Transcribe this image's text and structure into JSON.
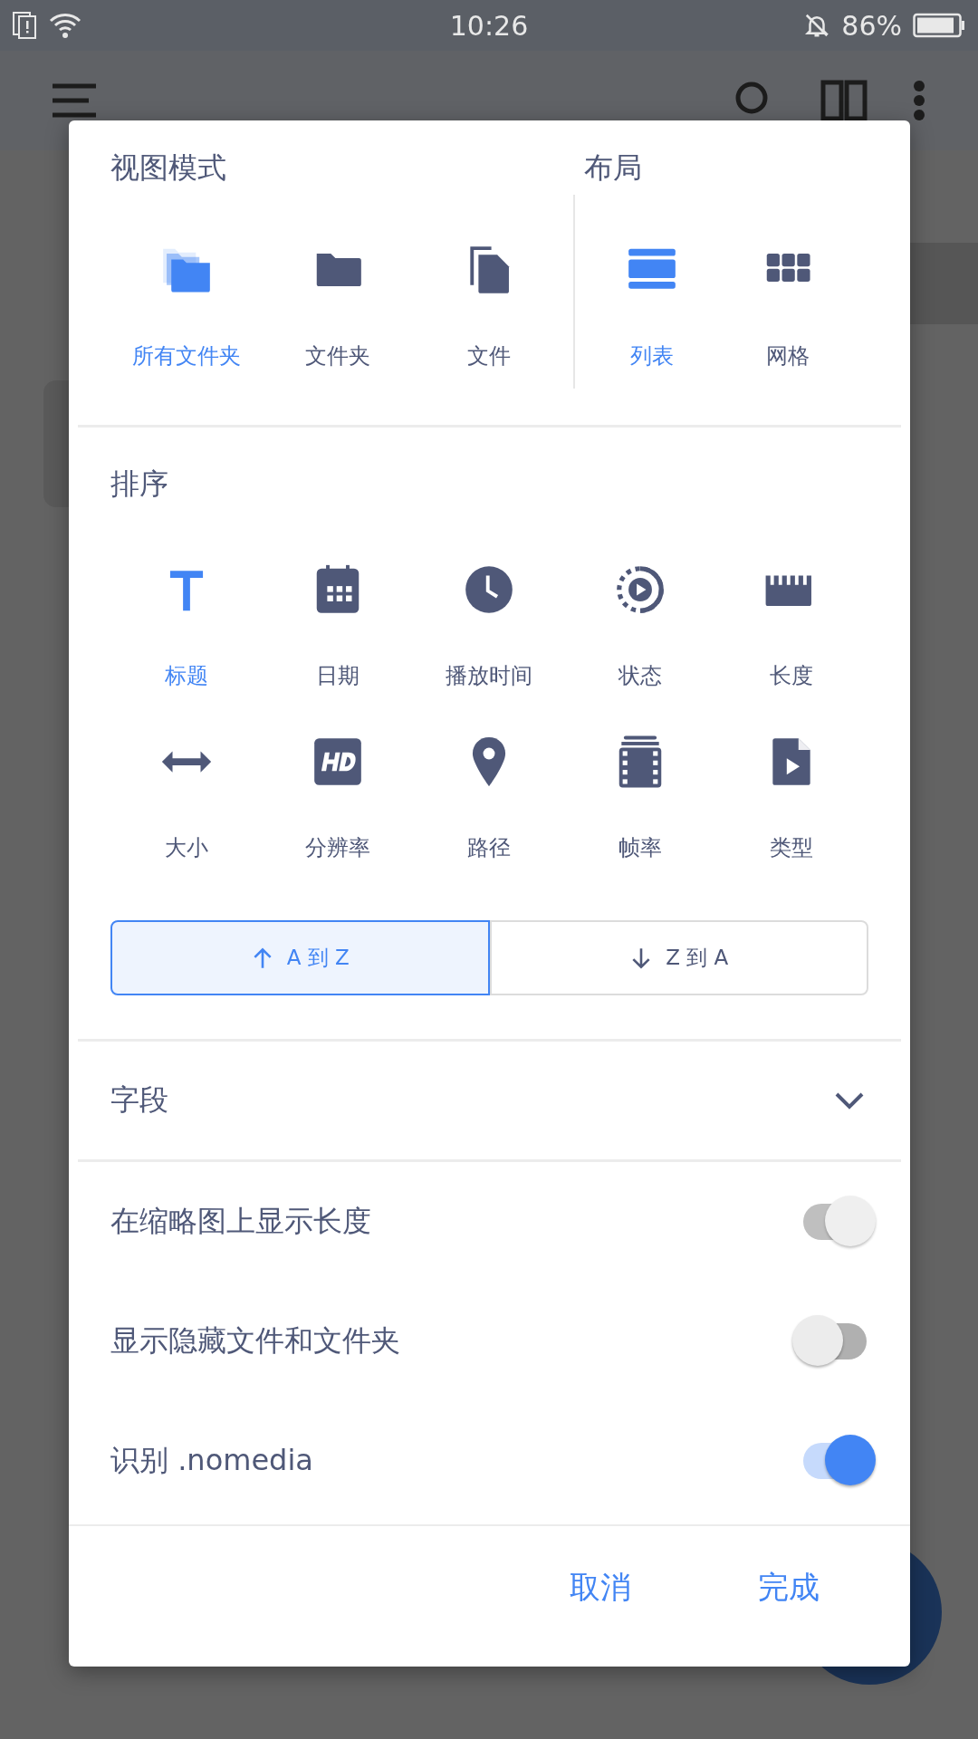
{
  "status_bar": {
    "time": "10:26",
    "battery": "86%"
  },
  "dialog": {
    "view_mode": {
      "title": "视图模式",
      "items": [
        {
          "kind": "all-folders",
          "label": "所有文件夹",
          "selected": true
        },
        {
          "kind": "folder",
          "label": "文件夹",
          "selected": false
        },
        {
          "kind": "file",
          "label": "文件",
          "selected": false
        }
      ]
    },
    "layout": {
      "title": "布局",
      "items": [
        {
          "kind": "list",
          "label": "列表",
          "selected": true
        },
        {
          "kind": "grid",
          "label": "网格",
          "selected": false
        }
      ]
    },
    "sort": {
      "title": "排序",
      "items": [
        {
          "kind": "title",
          "label": "标题",
          "selected": true
        },
        {
          "kind": "date",
          "label": "日期",
          "selected": false
        },
        {
          "kind": "clock",
          "label": "播放时间",
          "selected": false
        },
        {
          "kind": "status",
          "label": "状态",
          "selected": false
        },
        {
          "kind": "ruler",
          "label": "长度",
          "selected": false
        },
        {
          "kind": "size",
          "label": "大小",
          "selected": false
        },
        {
          "kind": "hd",
          "label": "分辨率",
          "selected": false
        },
        {
          "kind": "pin",
          "label": "路径",
          "selected": false
        },
        {
          "kind": "film",
          "label": "帧率",
          "selected": false
        },
        {
          "kind": "video-file",
          "label": "类型",
          "selected": false
        }
      ],
      "order": [
        {
          "kind": "up",
          "label": "A 到 Z",
          "selected": true
        },
        {
          "kind": "down",
          "label": "Z 到 A",
          "selected": false
        }
      ]
    },
    "fields": {
      "label": "字段",
      "expanded": false
    },
    "toggles": [
      {
        "label": "在缩略图上显示长度",
        "on": true,
        "disabled": true
      },
      {
        "label": "显示隐藏文件和文件夹",
        "on": false,
        "disabled": false
      },
      {
        "label": "识别 .nomedia",
        "on": true,
        "disabled": false
      }
    ],
    "buttons": [
      {
        "label": "取消"
      },
      {
        "label": "完成"
      }
    ]
  }
}
